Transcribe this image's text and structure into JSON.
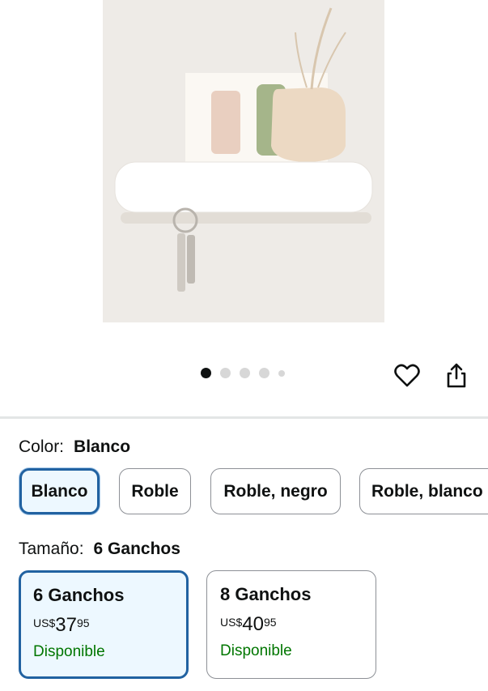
{
  "gallery": {
    "image_alt": "Estante blanco con ganchos para llaves",
    "page_count": 5,
    "active_page": 1
  },
  "icons": {
    "favorite": "heart-icon",
    "share": "share-icon"
  },
  "color": {
    "label": "Color:",
    "selected": "Blanco",
    "options": [
      "Blanco",
      "Roble",
      "Roble, negro",
      "Roble, blanco"
    ]
  },
  "size": {
    "label": "Tamaño:",
    "selected": "6 Ganchos",
    "options": [
      {
        "name": "6 Ganchos",
        "currency": "US$",
        "price_whole": "37",
        "price_fraction": "95",
        "availability": "Disponible"
      },
      {
        "name": "8 Ganchos",
        "currency": "US$",
        "price_whole": "40",
        "price_fraction": "95",
        "availability": "Disponible"
      }
    ]
  },
  "colors": {
    "accent": "#2162a1",
    "selected_bg": "#edf8ff",
    "available": "#007600"
  }
}
